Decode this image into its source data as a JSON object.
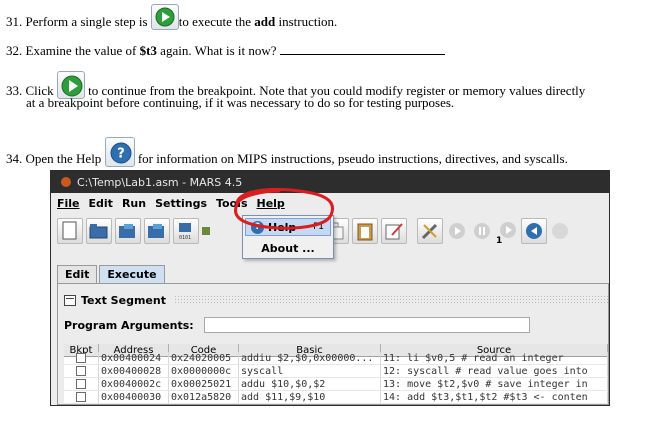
{
  "steps": [
    {
      "number": "31.",
      "before_icon": "Perform a single step is",
      "after_icon": "to execute the",
      "bold": "add",
      "tail": "instruction.",
      "icon": "step-forward-icon"
    },
    {
      "number": "32.",
      "text_a": "Examine the value of",
      "bold": "$t3",
      "text_b": "again.  What is it now?"
    },
    {
      "number": "33.",
      "before_icon": "Click",
      "after_icon": "to continue from the breakpoint. Note that you could modify register or memory values directly",
      "line2": "at a breakpoint before continuing, if it was necessary to do so for testing purposes.",
      "icon": "run-continue-icon"
    },
    {
      "number": "34.",
      "before_icon": "Open the Help",
      "after_icon": "for information on MIPS instructions, pseudo instructions, directives, and syscalls.",
      "icon": "help-icon"
    }
  ],
  "mars": {
    "title": "C:\\Temp\\Lab1.asm  - MARS 4.5",
    "menu": [
      "File",
      "Edit",
      "Run",
      "Settings",
      "Tools",
      "Help"
    ],
    "step_badge": "1",
    "tabs": [
      "Edit",
      "Execute"
    ],
    "text_segment_label": "Text Segment",
    "program_arguments_label": "Program Arguments:",
    "help_menu": {
      "items": [
        {
          "label": "Help",
          "shortcut": "F1"
        },
        {
          "label": "About ..."
        }
      ]
    },
    "columns": [
      "Bkpt",
      "Address",
      "Code",
      "Basic",
      "Source"
    ],
    "rows": [
      {
        "address": "0x00400024",
        "code": "0x24020005",
        "basic": "addiu $2,$0,0x00000...",
        "source": "11:  li $v0,5 # read an integer"
      },
      {
        "address": "0x00400028",
        "code": "0x0000000c",
        "basic": "syscall",
        "source": "12:  syscall # read value goes into"
      },
      {
        "address": "0x0040002c",
        "code": "0x00025021",
        "basic": "addu $10,$0,$2",
        "source": "13:  move $t2,$v0 # save integer in"
      },
      {
        "address": "0x00400030",
        "code": "0x012a5820",
        "basic": "add $11,$9,$10",
        "source": "14:  add $t3,$t1,$t2 #$t3 <- conten"
      }
    ],
    "annotation_color": "#d81e1e",
    "accent_green": "#2e9e3a",
    "accent_blue": "#2f6fb0"
  }
}
